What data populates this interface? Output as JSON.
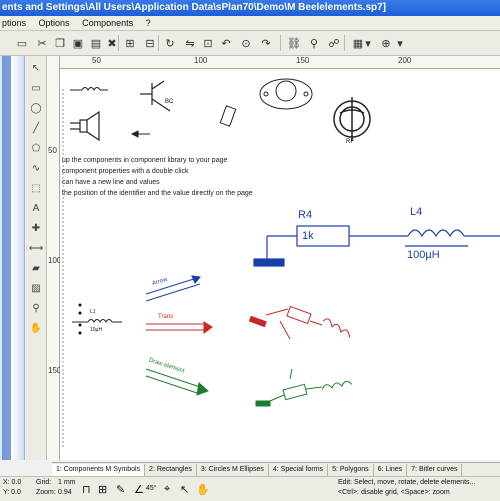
{
  "window": {
    "title": "ents and Settings\\All Users\\Application Data\\sPlan70\\Demo\\M Beelelements.sp7]"
  },
  "menu": [
    "ptions",
    "Options",
    "Components",
    "?"
  ],
  "rulers": {
    "h_labels": [
      "50",
      "100",
      "150",
      "200"
    ],
    "v_labels": [
      "50",
      "100",
      "150"
    ]
  },
  "canvas": {
    "notes": [
      "up the components in component library to your page",
      "component properties with a double click",
      "can have a new line and values",
      "the position of the identifier and the value directly on the page"
    ],
    "symbols": {
      "transistor_label": "BC",
      "tube_label": "RF",
      "coil_small_label": "L1",
      "coil_small_value": "10µH",
      "text_rotated_1": "Arrow",
      "text_red": "Trans",
      "text_green": "Draw element"
    },
    "circuit": {
      "r4_name": "R4",
      "r4_value": "1k",
      "l4_name": "L4",
      "l4_value": "100µH"
    }
  },
  "tabs": [
    {
      "label": "1: Components M Symbols",
      "active": true
    },
    {
      "label": "2: Rectangles"
    },
    {
      "label": "3: Circles M Ellipses"
    },
    {
      "label": "4: Special forms"
    },
    {
      "label": "5: Polygons"
    },
    {
      "label": "6: Lines"
    },
    {
      "label": "7: Bitler curves"
    }
  ],
  "status": {
    "coord_label_x": "X: 0.0",
    "coord_label_y": "Y: 0.0",
    "grid_label": "Grid:",
    "grid_value": "1 mm",
    "zoom_label": "Zoom:",
    "zoom_value": "0.94",
    "angle": "45°",
    "hint_line1": "Edit: Select, move, rotate, delete elements...",
    "hint_line2": "<Ctrl>: disable grid, <Space>: zoom"
  },
  "colors": {
    "accent": "#1d5ed8",
    "circuit_blue": "#1a3fa8",
    "red": "#c62828",
    "green": "#1e7d2c"
  }
}
